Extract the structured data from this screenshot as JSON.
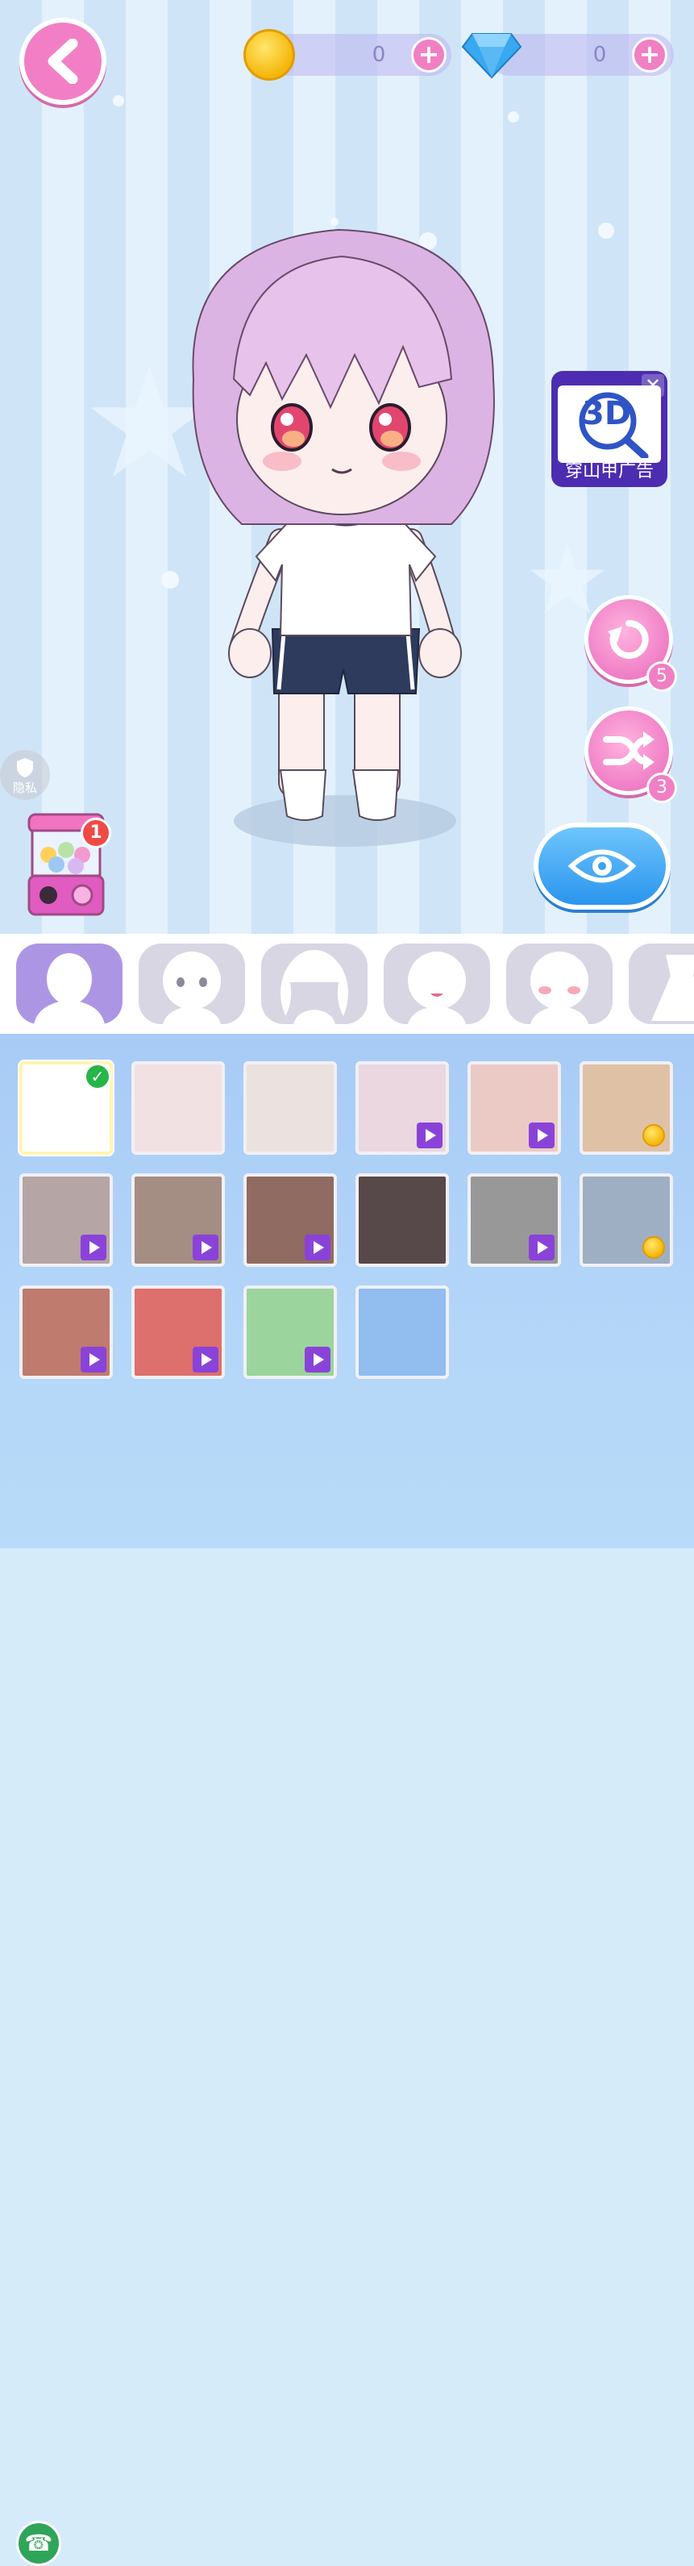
{
  "currency": {
    "coins": "0",
    "diamonds": "0",
    "add_symbol": "+"
  },
  "ad": {
    "logo": "3D",
    "label": "穿山甲广告",
    "close": "✕"
  },
  "side_buttons": {
    "undo_count": "5",
    "shuffle_count": "3"
  },
  "privacy": {
    "label": "隐私"
  },
  "gacha": {
    "badge": "1"
  },
  "tabs": [
    {
      "name": "body-skin",
      "active": true
    },
    {
      "name": "face"
    },
    {
      "name": "hair"
    },
    {
      "name": "mouth"
    },
    {
      "name": "blush"
    },
    {
      "name": "outfit"
    }
  ],
  "swatches": [
    {
      "color": "#ffffff",
      "lock": "selected"
    },
    {
      "color": "#f1e1e3",
      "lock": "none"
    },
    {
      "color": "#ebe1df",
      "lock": "none"
    },
    {
      "color": "#ead7df",
      "lock": "video"
    },
    {
      "color": "#ebcac6",
      "lock": "video"
    },
    {
      "color": "#dfc1a6",
      "lock": "coin"
    },
    {
      "color": "#b6a5a5",
      "lock": "video"
    },
    {
      "color": "#a48d82",
      "lock": "video"
    },
    {
      "color": "#8f6b61",
      "lock": "video"
    },
    {
      "color": "#574849",
      "lock": "none"
    },
    {
      "color": "#989898",
      "lock": "video"
    },
    {
      "color": "#9fafc3",
      "lock": "coin"
    },
    {
      "color": "#bf7b6e",
      "lock": "video"
    },
    {
      "color": "#dd6f6d",
      "lock": "video"
    },
    {
      "color": "#9cd49e",
      "lock": "video"
    },
    {
      "color": "#91bdef",
      "lock": "none"
    }
  ],
  "phone": {
    "icon": "☎"
  }
}
